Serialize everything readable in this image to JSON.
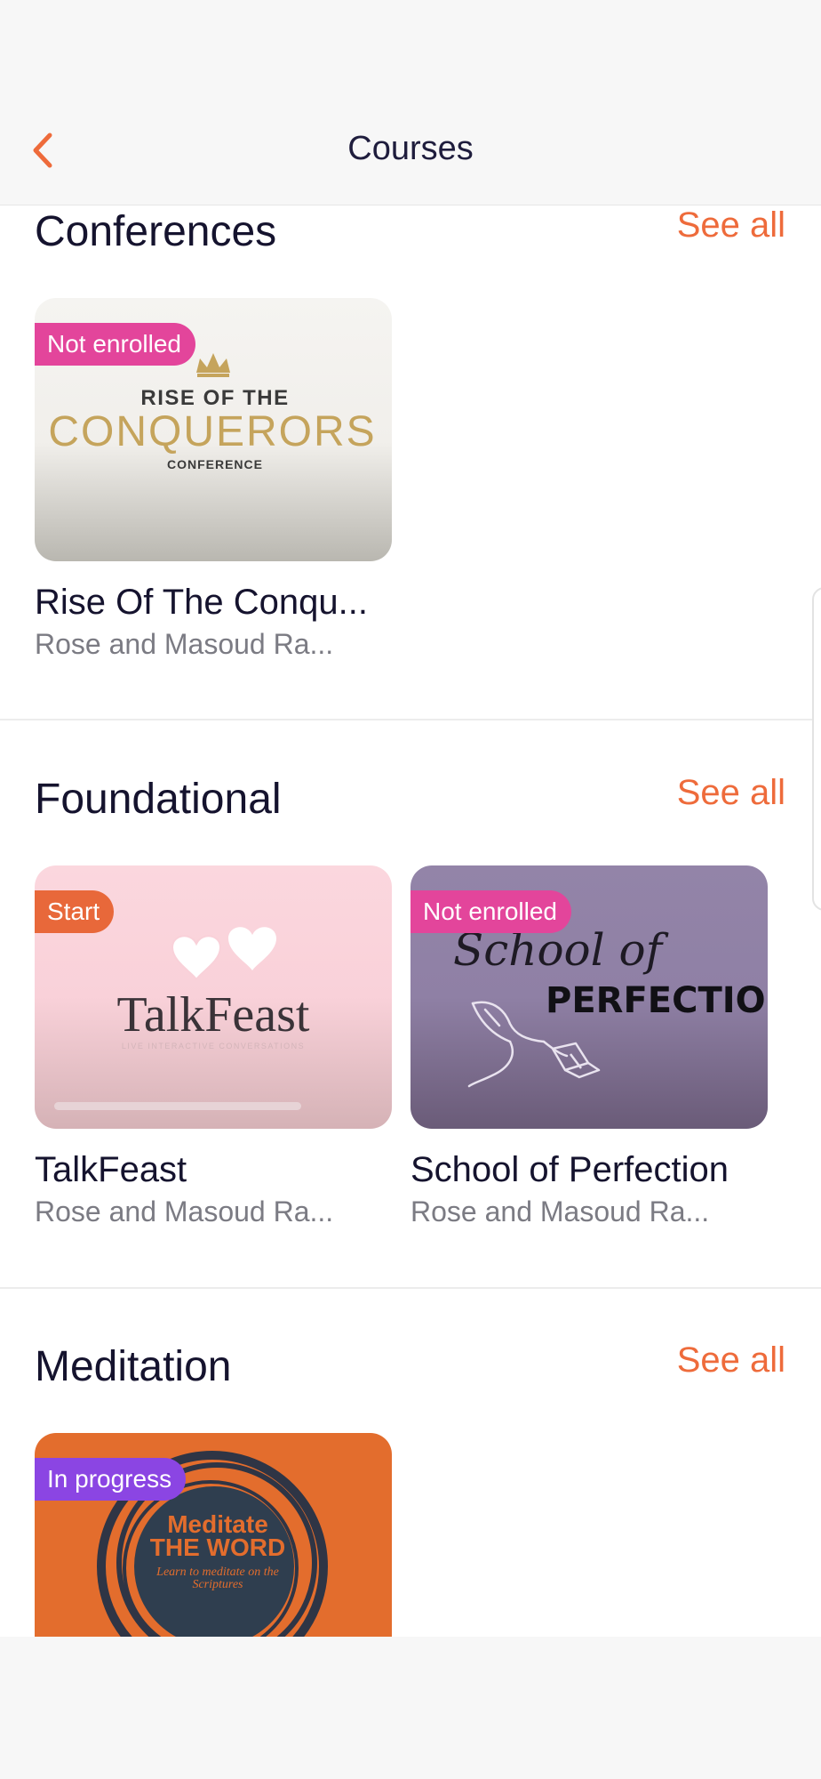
{
  "header": {
    "title": "Courses"
  },
  "sections": [
    {
      "title": "Conferences",
      "see_all": "See all",
      "courses": [
        {
          "badge": "Not enrolled",
          "badge_color": "#e3459b",
          "name": "Rise Of The Conqu...",
          "author": "Rose and Masoud Ra...",
          "art": {
            "line1": "RISE OF THE",
            "line2": "CONQUERORS",
            "line3": "CONFERENCE"
          }
        }
      ]
    },
    {
      "title": "Foundational",
      "see_all": "See all",
      "courses": [
        {
          "badge": "Start",
          "badge_color": "#e8683a",
          "name": "TalkFeast",
          "author": "Rose and Masoud Ra...",
          "art": {
            "logo": "TalkFeast",
            "tagline": "LIVE INTERACTIVE CONVERSATIONS"
          }
        },
        {
          "badge": "Not enrolled",
          "badge_color": "#e3459b",
          "name": "School of Perfection",
          "author": "Rose and Masoud Ra...",
          "art": {
            "line1": "School of",
            "line2": "PERFECTION"
          }
        }
      ]
    },
    {
      "title": "Meditation",
      "see_all": "See all",
      "courses": [
        {
          "badge": "In progress",
          "badge_color": "#8b45e3",
          "art": {
            "line1": "Meditate",
            "line2": "THE WORD",
            "line3": "Learn to meditate on the",
            "line4": "Scriptures"
          }
        }
      ]
    }
  ],
  "colors": {
    "accent": "#ee6b3b",
    "title_text": "#15132e",
    "subtitle_text": "#7b7b83"
  },
  "icons": {
    "back": "chevron-left-icon"
  }
}
